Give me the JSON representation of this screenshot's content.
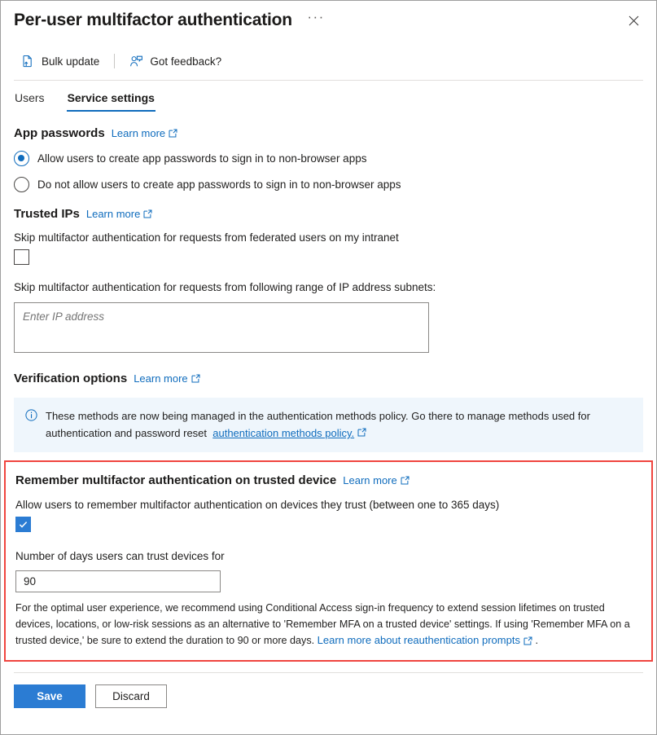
{
  "window": {
    "title": "Per-user multifactor authentication",
    "more_menu": "···",
    "close_icon": "close-icon"
  },
  "commandbar": {
    "items": [
      {
        "label": "Bulk update",
        "icon": "bulk-update-icon"
      },
      {
        "label": "Got feedback?",
        "icon": "feedback-icon"
      }
    ]
  },
  "tabs": [
    {
      "label": "Users",
      "active": false
    },
    {
      "label": "Service settings",
      "active": true
    }
  ],
  "app_passwords": {
    "heading": "App passwords",
    "learn_more": "Learn more",
    "options": [
      {
        "label": "Allow users to create app passwords to sign in to non-browser apps",
        "selected": true
      },
      {
        "label": "Do not allow users to create app passwords to sign in to non-browser apps",
        "selected": false
      }
    ]
  },
  "trusted_ips": {
    "heading": "Trusted IPs",
    "learn_more": "Learn more",
    "federated_label": "Skip multifactor authentication for requests from federated users on my intranet",
    "federated_checked": false,
    "subnets_label": "Skip multifactor authentication for requests from following range of IP address subnets:",
    "ip_value": "",
    "ip_placeholder": "Enter IP address"
  },
  "verification_options": {
    "heading": "Verification options",
    "learn_more": "Learn more",
    "info_icon": "info-icon",
    "info_text_part1": "These methods are now being managed in the authentication methods policy. Go there to manage methods used for authentication and password reset",
    "info_link": "authentication methods policy."
  },
  "remember_device": {
    "heading": "Remember multifactor authentication on trusted device",
    "learn_more": "Learn more",
    "allow_label": "Allow users to remember multifactor authentication on devices they trust (between one to 365 days)",
    "allow_checked": true,
    "days_label": "Number of days users can trust devices for",
    "days_value": "90",
    "note_part1": "For the optimal user experience, we recommend using Conditional Access sign-in frequency to extend session lifetimes on trusted devices, locations, or low-risk sessions as an alternative to 'Remember MFA on a trusted device' settings. If using 'Remember MFA on a trusted device,' be sure to extend the duration to 90 or more days.",
    "note_link": "Learn more about reauthentication prompts",
    "note_part2": ".",
    "highlight_color": "#f0453f"
  },
  "footer": {
    "save_label": "Save",
    "discard_label": "Discard"
  },
  "colors": {
    "accent": "#0f6cbd",
    "primary_button": "#2b7cd3",
    "info_bg": "#eff6fc",
    "highlight": "#f0453f"
  }
}
